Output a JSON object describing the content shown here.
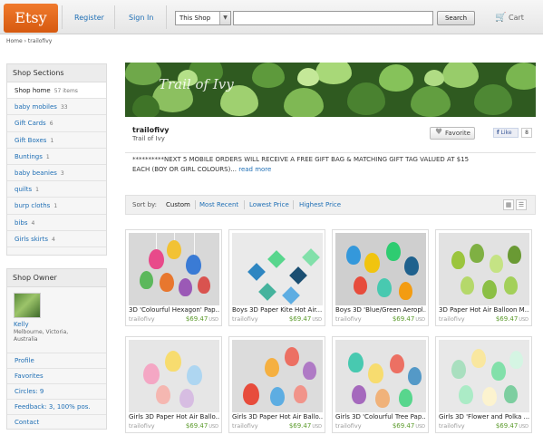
{
  "header": {
    "logo": "Etsy",
    "register": "Register",
    "sign_in": "Sign In",
    "scope_select": "This Shop",
    "search_value": "",
    "search_button": "Search",
    "cart": "Cart",
    "cart_icon": "cart-icon"
  },
  "breadcrumb": "Home › trailofivy",
  "sections": {
    "title": "Shop Sections",
    "items": [
      {
        "label": "Shop home",
        "count": "57 items"
      },
      {
        "label": "baby mobiles",
        "count": "33"
      },
      {
        "label": "Gift Cards",
        "count": "6"
      },
      {
        "label": "Gift Boxes",
        "count": "1"
      },
      {
        "label": "Buntings",
        "count": "1"
      },
      {
        "label": "baby beanies",
        "count": "3"
      },
      {
        "label": "quilts",
        "count": "1"
      },
      {
        "label": "burp cloths",
        "count": "1"
      },
      {
        "label": "bibs",
        "count": "4"
      },
      {
        "label": "Girls skirts",
        "count": "4"
      }
    ]
  },
  "owner": {
    "title": "Shop Owner",
    "name": "Kelly",
    "location": "Melbourne, Victoria, Australia",
    "links": [
      "Profile",
      "Favorites",
      "Circles: 9",
      "Feedback: 3, 100% pos.",
      "Contact"
    ]
  },
  "shop": {
    "banner_text": "Trail of Ivy",
    "name": "trailofivy",
    "title": "Trail of Ivy",
    "favorite": "Favorite",
    "like": "Like",
    "like_count": "8",
    "announcement": "**********NEXT 5 MOBILE ORDERS WILL RECEIVE A FREE GIFT BAG & MATCHING GIFT TAG VALUED AT $15 EACH (BOY OR GIRL COLOURS)...",
    "read_more": "read more"
  },
  "sort": {
    "label": "Sort by:",
    "options": [
      "Custom",
      "Most Recent",
      "Lowest Price",
      "Highest Price"
    ]
  },
  "listings": [
    {
      "title": "3D 'Colourful Hexagon' Pap...",
      "shop": "trailofivy",
      "price": "$69.47",
      "currency": "USD"
    },
    {
      "title": "Boys 3D Paper Kite Hot Air...",
      "shop": "trailofivy",
      "price": "$69.47",
      "currency": "USD"
    },
    {
      "title": "Boys 3D 'Blue/Green Aeropl...",
      "shop": "trailofivy",
      "price": "$69.47",
      "currency": "USD"
    },
    {
      "title": "3D Paper Hot Air Balloon M...",
      "shop": "trailofivy",
      "price": "$69.47",
      "currency": "USD"
    },
    {
      "title": "Girls 3D Paper Hot Air Ballo...",
      "shop": "trailofivy",
      "price": "$69.47",
      "currency": "USD"
    },
    {
      "title": "Girls 3D Paper Hot Air Ballo...",
      "shop": "trailofivy",
      "price": "$69.47",
      "currency": "USD"
    },
    {
      "title": "Girls 3D 'Colourful Tree Pap...",
      "shop": "trailofivy",
      "price": "$69.47",
      "currency": "USD"
    },
    {
      "title": "Girls 3D 'Flower and Polka ...",
      "shop": "trailofivy",
      "price": "$69.47",
      "currency": "USD"
    }
  ],
  "colors": {
    "brand": "#e8671c",
    "link": "#1f6fb5",
    "price": "#5a9a2a"
  }
}
